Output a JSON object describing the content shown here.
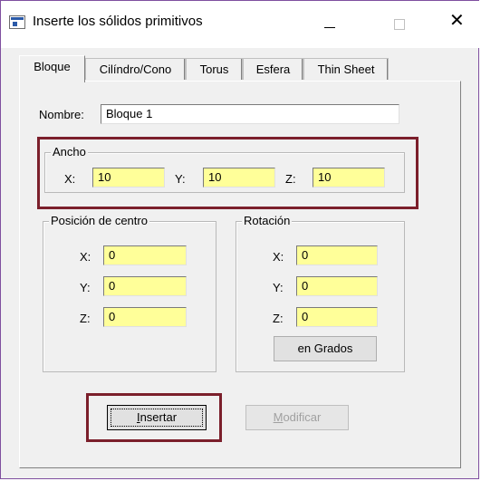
{
  "window": {
    "title": "Inserte los sólidos primitivos",
    "minimize_glyph": "—",
    "maximize_glyph": "☐",
    "close_glyph": "✕"
  },
  "tabs": [
    {
      "label": "Bloque",
      "active": true
    },
    {
      "label": "Cilíndro/Cono",
      "active": false
    },
    {
      "label": "Torus",
      "active": false
    },
    {
      "label": "Esfera",
      "active": false
    },
    {
      "label": "Thin Sheet",
      "active": false
    }
  ],
  "nombre": {
    "label": "Nombre:",
    "value": "Bloque 1"
  },
  "ancho": {
    "title": "Ancho",
    "x": {
      "label": "X:",
      "value": "10"
    },
    "y": {
      "label": "Y:",
      "value": "10"
    },
    "z": {
      "label": "Z:",
      "value": "10"
    }
  },
  "posicion": {
    "title": "Posición de centro",
    "x": {
      "label": "X:",
      "value": "0"
    },
    "y": {
      "label": "Y:",
      "value": "0"
    },
    "z": {
      "label": "Z:",
      "value": "0"
    }
  },
  "rotacion": {
    "title": "Rotación",
    "x": {
      "label": "X:",
      "value": "0"
    },
    "y": {
      "label": "Y:",
      "value": "0"
    },
    "z": {
      "label": "Z:",
      "value": "0"
    },
    "units_button": "en Grados"
  },
  "actions": {
    "insert_prefix": "I",
    "insert_rest": "nsertar",
    "modify_prefix": "M",
    "modify_rest": "odificar"
  },
  "colors": {
    "input_highlight": "#ffff99",
    "annotation_box": "#7b1f2b"
  }
}
